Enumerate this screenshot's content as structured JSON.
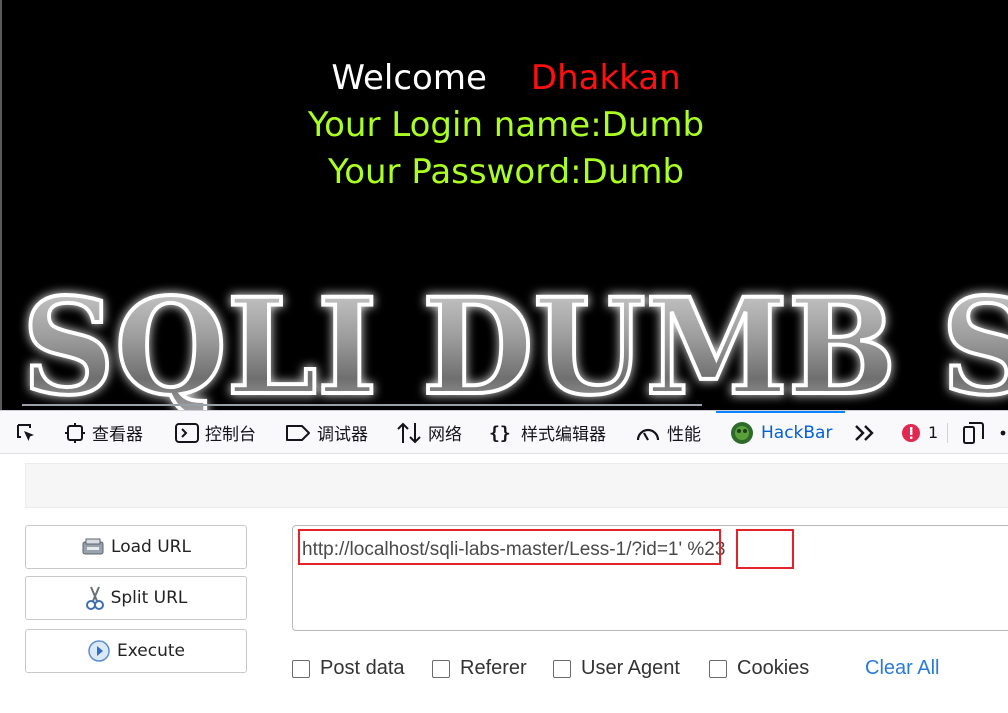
{
  "page": {
    "welcome_word": "Welcome",
    "welcome_name": "Dhakkan",
    "login_line": "Your Login name:Dumb",
    "password_line": "Your Password:Dumb",
    "banner_text": "SQLI DUMB SE"
  },
  "devtools": {
    "tabs": [
      {
        "label": "查看器",
        "icon": "inspector-icon"
      },
      {
        "label": "控制台",
        "icon": "console-icon"
      },
      {
        "label": "调试器",
        "icon": "debugger-icon"
      },
      {
        "label": "网络",
        "icon": "network-icon"
      },
      {
        "label": "样式编辑器",
        "icon": "style-editor-icon"
      },
      {
        "label": "性能",
        "icon": "performance-icon"
      },
      {
        "label": "HackBar",
        "icon": "hackbar-icon"
      }
    ],
    "error_count": "1"
  },
  "hackbar": {
    "load_url": "Load URL",
    "split_url": "Split URL",
    "execute": "Execute",
    "url_part1": "http://localhost/sqli-labs-master/Less-1/?id=1'",
    "url_part2": " %23",
    "options": [
      "Post data",
      "Referer",
      "User Agent",
      "Cookies"
    ],
    "clear_all": "Clear All"
  },
  "colors": {
    "green_text": "#aaff22",
    "red_name": "#ff1010",
    "hackbar_active": "#0060df",
    "annotation_red": "#e2232a",
    "link_blue": "#2a7bd6"
  }
}
